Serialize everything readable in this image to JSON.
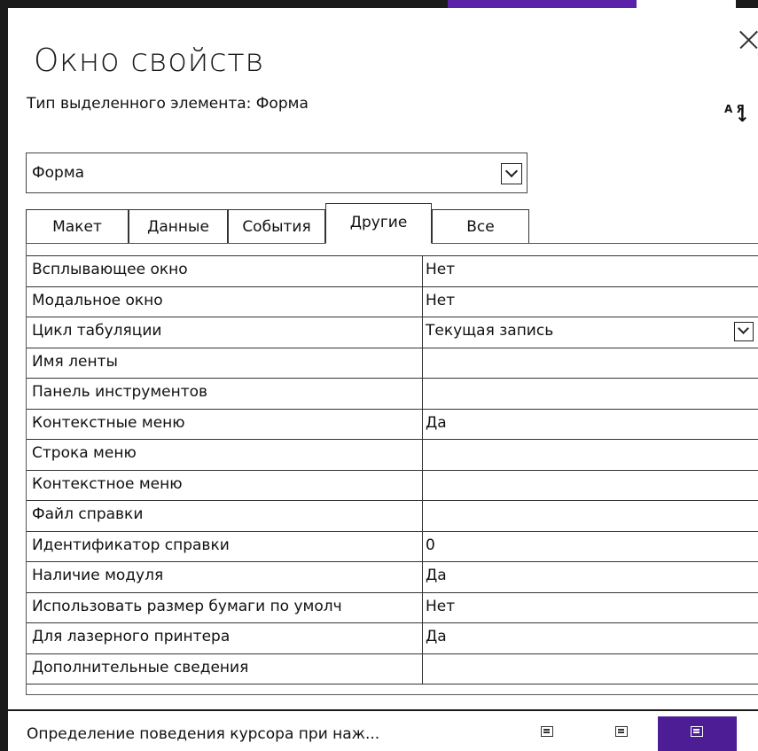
{
  "window": {
    "title": "Окно свойств",
    "subtitle": "Тип выделенного элемента:  Форма",
    "sort_letters": "А Я",
    "sort_arrow": "↓"
  },
  "selector": {
    "value": "Форма"
  },
  "tabs": [
    {
      "label": "Макет"
    },
    {
      "label": "Данные"
    },
    {
      "label": "События"
    },
    {
      "label": "Другие",
      "active": true
    },
    {
      "label": "Все"
    }
  ],
  "properties": [
    {
      "name": "Всплывающее окно",
      "value": "Нет"
    },
    {
      "name": "Модальное окно",
      "value": "Нет"
    },
    {
      "name": "Цикл табуляции",
      "value": "Текущая запись"
    },
    {
      "name": "Имя ленты",
      "value": ""
    },
    {
      "name": "Панель инструментов",
      "value": ""
    },
    {
      "name": "Контекстные меню",
      "value": "Да"
    },
    {
      "name": "Строка меню",
      "value": ""
    },
    {
      "name": "Контекстное меню",
      "value": ""
    },
    {
      "name": "Файл справки",
      "value": ""
    },
    {
      "name": "Идентификатор справки",
      "value": "0"
    },
    {
      "name": "Наличие модуля",
      "value": "Да"
    },
    {
      "name": "Использовать размер бумаги по умолч",
      "value": "Нет"
    },
    {
      "name": "Для лазерного принтера",
      "value": "Да"
    },
    {
      "name": "Дополнительные сведения",
      "value": ""
    }
  ],
  "status": {
    "text": "Определение поведения курсора при наж...",
    "icons": [
      "form-view-icon",
      "datasheet-view-icon",
      "design-view-icon"
    ]
  },
  "colors": {
    "accent": "#5b21a8",
    "active_view": "#4c1d95"
  }
}
